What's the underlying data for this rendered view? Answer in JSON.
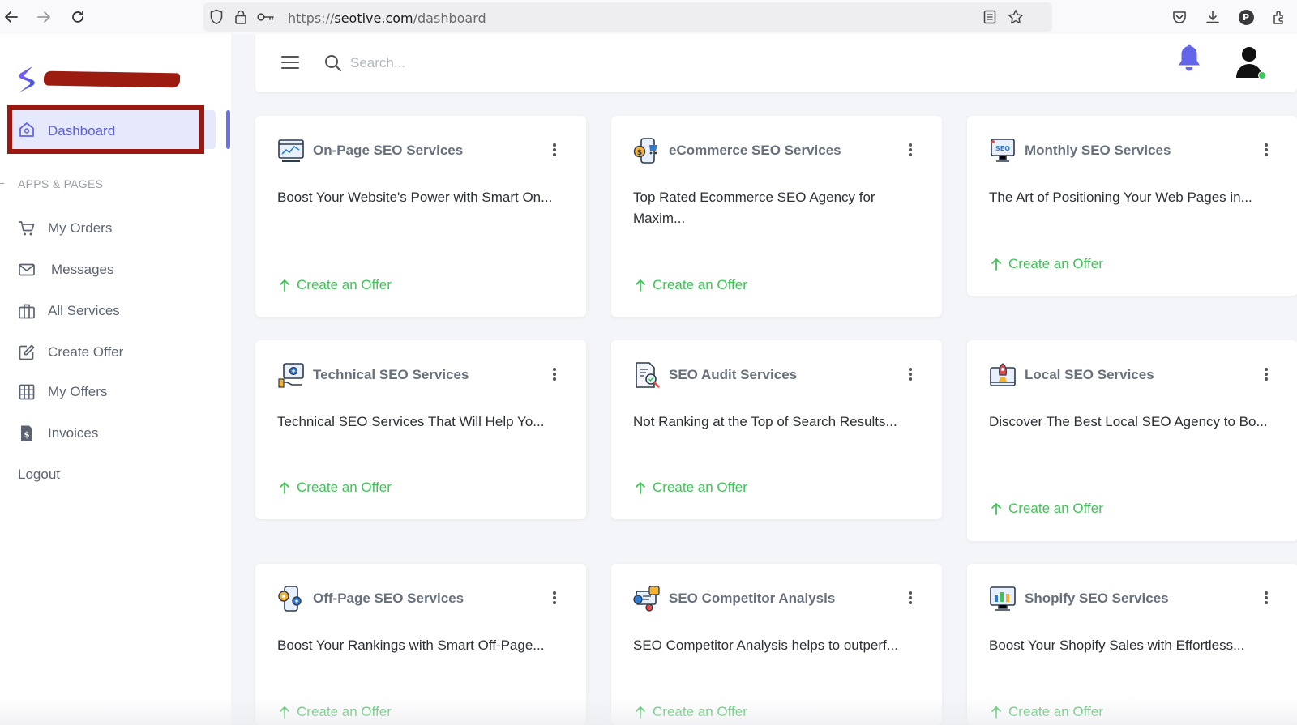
{
  "browser": {
    "url_prefix": "https://",
    "url_domain": "seotive.com",
    "url_path": "/dashboard",
    "profile_initial": "P"
  },
  "sidebar": {
    "active_item": "Dashboard",
    "section_title": "APPS & PAGES",
    "items": [
      {
        "label": "My Orders",
        "icon": "cart-icon"
      },
      {
        "label": "Messages",
        "icon": "mail-icon"
      },
      {
        "label": "All Services",
        "icon": "briefcase-icon"
      },
      {
        "label": "Create Offer",
        "icon": "edit-icon"
      },
      {
        "label": "My Offers",
        "icon": "grid-icon"
      },
      {
        "label": "Invoices",
        "icon": "invoice-icon"
      }
    ],
    "logout": "Logout"
  },
  "topbar": {
    "search_placeholder": "Search..."
  },
  "cards": [
    {
      "title": "On-Page SEO Services",
      "desc": "Boost Your Website's Power with Smart On...",
      "cta": "Create an Offer"
    },
    {
      "title": "eCommerce SEO Services",
      "desc": "Top Rated Ecommerce SEO Agency for Maxim...",
      "cta": "Create an Offer"
    },
    {
      "title": "Monthly SEO Services",
      "desc": "The Art of Positioning Your Web Pages in...",
      "cta": "Create an Offer"
    },
    {
      "title": "Technical SEO Services",
      "desc": "Technical SEO Services That Will Help Yo...",
      "cta": "Create an Offer"
    },
    {
      "title": "SEO Audit Services",
      "desc": "Not Ranking at the Top of Search Results...",
      "cta": "Create an Offer"
    },
    {
      "title": "Local SEO Services",
      "desc": "Discover The Best Local SEO Agency to Bo...",
      "cta": "Create an Offer"
    },
    {
      "title": "Off-Page SEO Services",
      "desc": "Boost Your Rankings with Smart Off-Page...",
      "cta": "Create an Offer"
    },
    {
      "title": "SEO Competitor Analysis",
      "desc": "SEO Competitor Analysis helps to outperf...",
      "cta": "Create an Offer"
    },
    {
      "title": "Shopify SEO Services",
      "desc": "Boost Your Shopify Sales with Effortless...",
      "cta": "Create an Offer"
    }
  ],
  "colors": {
    "accent": "#5b5fdb",
    "cta_green": "#3ec456",
    "bell": "#6366e8",
    "highlight_red": "#9b1810"
  }
}
